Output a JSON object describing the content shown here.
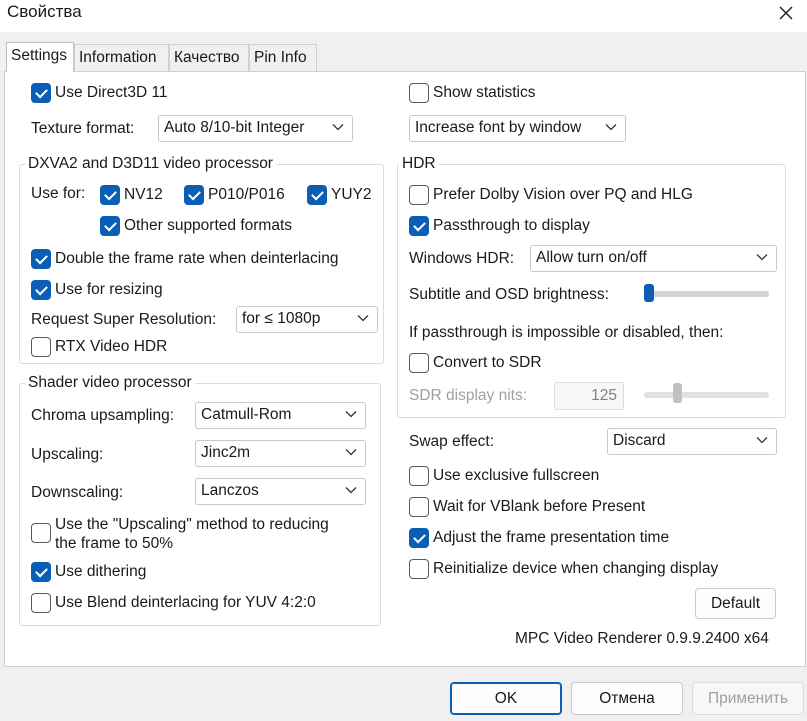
{
  "window": {
    "title": "Свойства"
  },
  "tabs": [
    {
      "label": "Settings"
    },
    {
      "label": "Information"
    },
    {
      "label": "Качество"
    },
    {
      "label": "Pin Info"
    }
  ],
  "left": {
    "use_d3d11": {
      "label": "Use Direct3D 11",
      "checked": true
    },
    "texture_format": {
      "label": "Texture format:",
      "value": "Auto 8/10-bit Integer"
    },
    "dxva": {
      "title": "DXVA2 and D3D11 video processor",
      "use_for_label": "Use for:",
      "nv12": {
        "label": "NV12",
        "checked": true
      },
      "p010": {
        "label": "P010/P016",
        "checked": true
      },
      "yuy2": {
        "label": "YUY2",
        "checked": true
      },
      "other": {
        "label": "Other supported formats",
        "checked": true
      },
      "double_rate": {
        "label": "Double the frame rate when deinterlacing",
        "checked": true
      },
      "resizing": {
        "label": "Use for resizing",
        "checked": true
      },
      "super_res": {
        "label": "Request Super Resolution:",
        "value": "for ≤ 1080p"
      },
      "rtx_hdr": {
        "label": "RTX Video HDR",
        "checked": false
      }
    },
    "shader": {
      "title": "Shader video processor",
      "chroma": {
        "label": "Chroma upsampling:",
        "value": "Catmull-Rom"
      },
      "upscaling": {
        "label": "Upscaling:",
        "value": "Jinc2m"
      },
      "downscaling": {
        "label": "Downscaling:",
        "value": "Lanczos"
      },
      "upscale_reduce": {
        "line1": "Use the \"Upscaling\" method to reducing",
        "line2": "the frame to 50%",
        "checked": false
      },
      "dithering": {
        "label": "Use dithering",
        "checked": true
      },
      "blend": {
        "label": "Use Blend deinterlacing for YUV 4:2:0",
        "checked": false
      }
    }
  },
  "right": {
    "show_stats": {
      "label": "Show statistics",
      "checked": false
    },
    "font_mode": {
      "value": "Increase font by window"
    },
    "hdr": {
      "title": "HDR",
      "dolby": {
        "label": "Prefer Dolby Vision over PQ and HLG",
        "checked": false
      },
      "passthrough": {
        "label": "Passthrough to display",
        "checked": true
      },
      "windows_hdr": {
        "label": "Windows HDR:",
        "value": "Allow turn on/off"
      },
      "brightness": {
        "label": "Subtitle and OSD brightness:",
        "level": 0
      },
      "impossible_label": "If passthrough is impossible or disabled, then:",
      "convert_sdr": {
        "label": "Convert to SDR",
        "checked": false
      },
      "sdr_nits": {
        "label": "SDR display nits:",
        "value": "125",
        "level": 0.25
      }
    },
    "swap_effect": {
      "label": "Swap effect:",
      "value": "Discard"
    },
    "exclusive_fullscreen": {
      "label": "Use exclusive fullscreen",
      "checked": false
    },
    "vblank": {
      "label": "Wait for VBlank before Present",
      "checked": false
    },
    "adjust_time": {
      "label": "Adjust the frame presentation time",
      "checked": true
    },
    "reinit": {
      "label": "Reinitialize device when changing display",
      "checked": false
    },
    "default_label": "Default",
    "version": "MPC Video Renderer 0.9.9.2400 x64"
  },
  "footer": {
    "ok": "OK",
    "cancel": "Отмена",
    "apply": "Применить"
  },
  "colors": {
    "accent": "#0a5eb6"
  },
  "icons": {
    "close": "close-icon",
    "chevron": "chevron-down-icon"
  }
}
